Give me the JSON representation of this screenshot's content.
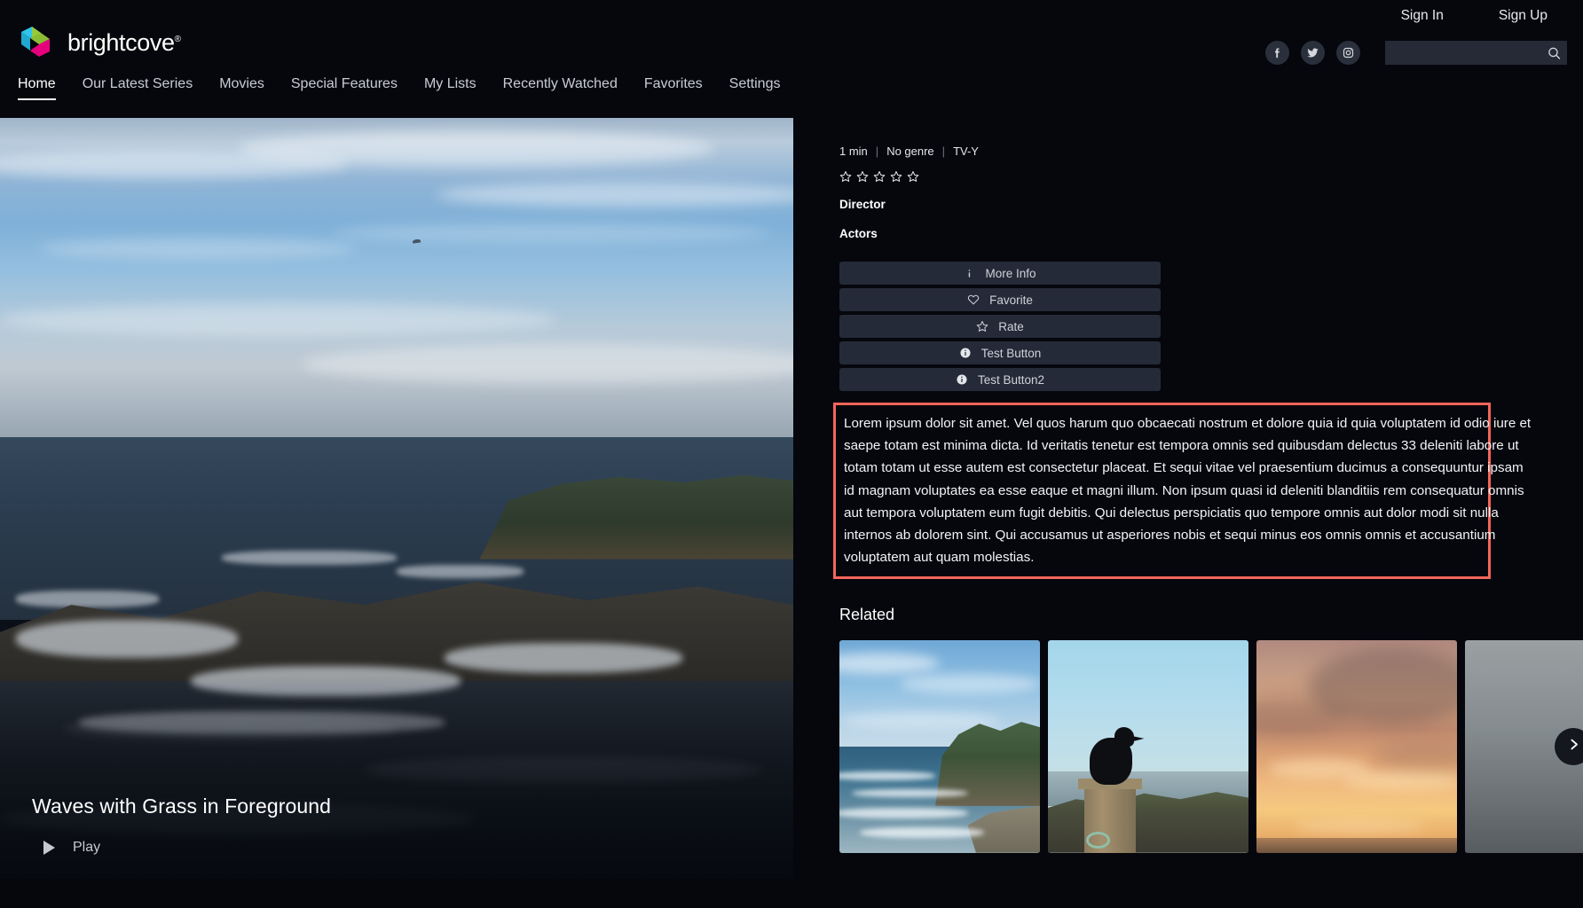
{
  "header": {
    "logo_text": "brightcove",
    "logo_tm": "®",
    "logo_icon": "brightcove-chevrons-logo",
    "auth": [
      {
        "label": "Sign In",
        "name": "sign-in-link"
      },
      {
        "label": "Sign Up",
        "name": "sign-up-link"
      }
    ],
    "social": [
      {
        "name": "facebook-icon",
        "label": "Facebook"
      },
      {
        "name": "twitter-icon",
        "label": "Twitter"
      },
      {
        "name": "instagram-icon",
        "label": "Instagram"
      }
    ],
    "search": {
      "value": "",
      "placeholder": "",
      "icon": "search-icon"
    }
  },
  "nav": {
    "items": [
      {
        "label": "Home",
        "active": true
      },
      {
        "label": "Our Latest Series",
        "active": false
      },
      {
        "label": "Movies",
        "active": false
      },
      {
        "label": "Special Features",
        "active": false
      },
      {
        "label": "My Lists",
        "active": false
      },
      {
        "label": "Recently Watched",
        "active": false
      },
      {
        "label": "Favorites",
        "active": false
      },
      {
        "label": "Settings",
        "active": false
      }
    ]
  },
  "player": {
    "title": "Waves with Grass in Foreground",
    "play_label": "Play",
    "play_icon": "play-triangle-icon",
    "poster_description": "coastal-ocean-rocks-video-frame"
  },
  "detail": {
    "duration": "1 min",
    "genre": "No genre",
    "rating": "TV-Y",
    "separator": "|",
    "star_count": 5,
    "stars_filled": 0,
    "star_icon": "star-outline-icon",
    "director_label": "Director",
    "actors_label": "Actors",
    "buttons": [
      {
        "label": "More Info",
        "icon": "info-letter-icon",
        "name": "more-info-button"
      },
      {
        "label": "Favorite",
        "icon": "heart-outline-icon",
        "name": "favorite-button"
      },
      {
        "label": "Rate",
        "icon": "star-outline-icon",
        "name": "rate-button"
      },
      {
        "label": "Test Button",
        "icon": "info-circle-filled-icon",
        "name": "test-button"
      },
      {
        "label": "Test Button2",
        "icon": "info-circle-filled-icon",
        "name": "test-button-2"
      }
    ],
    "description": "Lorem ipsum dolor sit amet. Vel quos harum quo obcaecati nostrum et dolore quia id quia voluptatem id odio iure et saepe totam est minima dicta. Id veritatis tenetur est tempora omnis sed quibusdam delectus 33 deleniti labore ut totam totam ut esse autem est consectetur placeat. Et sequi vitae vel praesentium ducimus a consequuntur ipsam id magnam voluptates ea esse eaque et magni illum. Non ipsum quasi id deleniti blanditiis rem consequatur omnis aut tempora voluptatem eum fugit debitis. Qui delectus perspiciatis quo tempore omnis aut dolor modi sit nulla internos ab dolorem sint. Qui accusamus ut asperiores nobis et sequi minus eos omnis omnis et accusantium voluptatem aut quam molestias.",
    "description_highlight_color": "#f4655a"
  },
  "related": {
    "title": "Related",
    "next_icon": "chevron-right-icon",
    "items": [
      {
        "name": "related-thumb-coastal-cliffs"
      },
      {
        "name": "related-thumb-crow-on-post"
      },
      {
        "name": "related-thumb-orange-sunset"
      },
      {
        "name": "related-thumb-grey-partial"
      }
    ]
  },
  "colors": {
    "background": "#05070d",
    "button": "#252a38",
    "highlight": "#f4655a",
    "text_primary": "#ffffff",
    "text_secondary": "#c9ccd2",
    "logo_cyan": "#2ec5e8",
    "logo_green": "#97c93d",
    "logo_magenta": "#e6007e"
  }
}
